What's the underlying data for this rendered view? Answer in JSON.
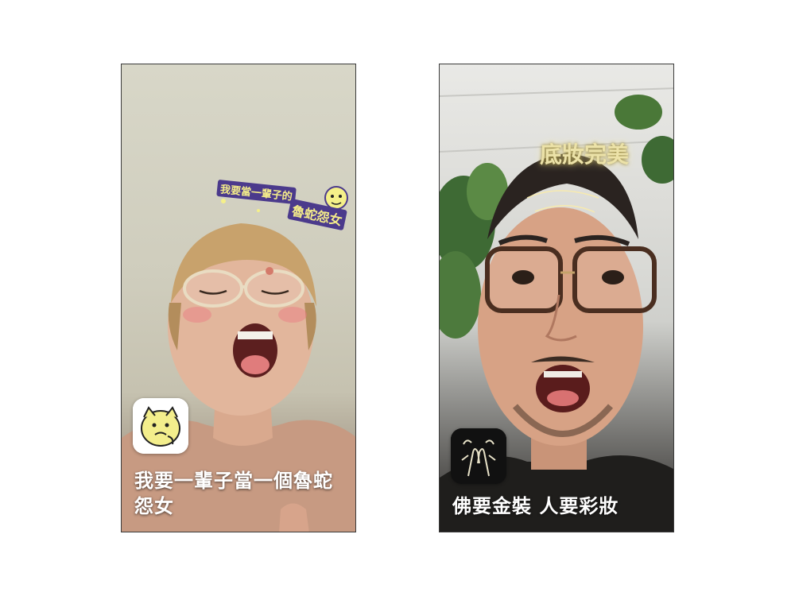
{
  "posts": [
    {
      "caption": "我要一輩子當一個魯蛇怨女",
      "ar_text_line1": "我要當一輩子的",
      "ar_text_line2": "魯蛇怨女",
      "filter_icon": "cartoon-face-icon"
    },
    {
      "caption": "佛要金裝 人要彩妝",
      "ar_text": "底妝完美",
      "filter_icon": "praying-hands-icon"
    }
  ]
}
